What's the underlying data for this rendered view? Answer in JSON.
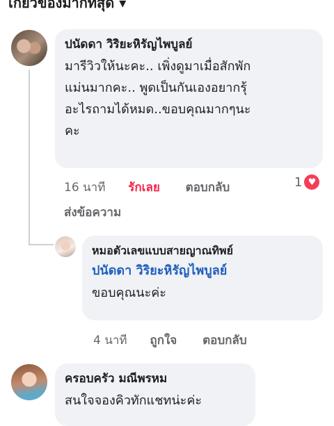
{
  "header": {
    "title_partial": "เกี่ยวข้องมากที่สุด ▾"
  },
  "comments": [
    {
      "author": "ปนัดดา วิริยะหิรัญไพบูลย์",
      "text_lines": [
        "มารีวิวให้นะคะ.. เพิ่งดูมาเมื่อสักพัก",
        "แม่นมากคะ.. พูดเป็นกันเองอยากรุ้",
        "อะไรถามได้หมด..ขอบคุณมากๆนะ",
        "คะ"
      ],
      "time": "16 นาที",
      "like_label": "รักเลย",
      "reply_label": "ตอบกลับ",
      "send_message_label": "ส่งข้อความ",
      "reaction_count": "1",
      "reaction_icon": "heart-icon",
      "reaction_color": "#f33e58"
    },
    {
      "author": "หมอตัวเลขแบบสายญาณทิพย์",
      "mention": "ปนัดดา วิริยะหิรัญไพบูลย์",
      "text": "ขอบคุณนะค่ะ",
      "time": "4 นาที",
      "like_label": "ถูกใจ",
      "reply_label": "ตอบกลับ"
    },
    {
      "author": "ครอบครัว มณีพรหม",
      "text": "สนใจจองคิวทักแชทน่ะค่ะ"
    }
  ],
  "colors": {
    "bubble": "#f0f2f5",
    "mention": "#1f5fbf",
    "love": "#f02849",
    "meta": "#65676b"
  }
}
